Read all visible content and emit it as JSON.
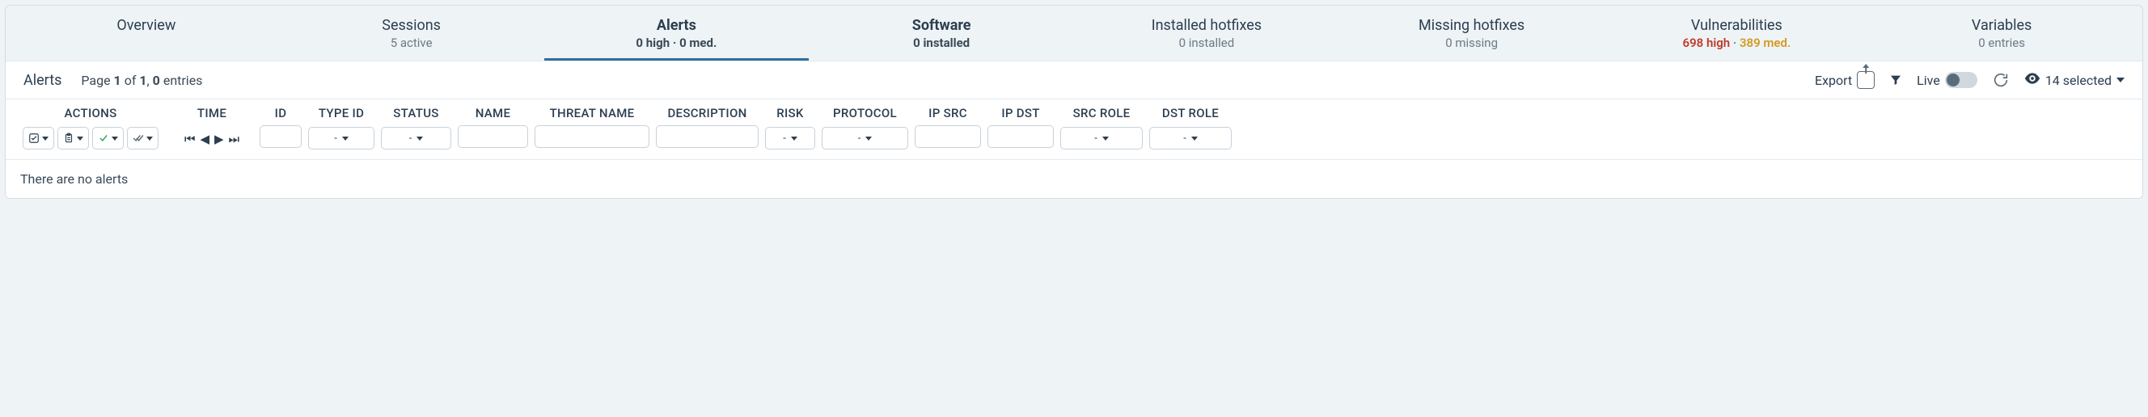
{
  "tabs": [
    {
      "title": "Overview",
      "subtitle": "",
      "bold": false,
      "active": false
    },
    {
      "title": "Sessions",
      "subtitle": "5 active",
      "bold": false,
      "active": false
    },
    {
      "title": "Alerts",
      "subtitle": "0 high · 0 med.",
      "bold": true,
      "active": true
    },
    {
      "title": "Software",
      "subtitle": "0 installed",
      "bold": true,
      "active": false
    },
    {
      "title": "Installed hotfixes",
      "subtitle": "0 installed",
      "bold": false,
      "active": false
    },
    {
      "title": "Missing hotfixes",
      "subtitle": "0 missing",
      "bold": false,
      "active": false
    },
    {
      "title": "Vulnerabilities",
      "subtitle_vuln": {
        "high": "698 high",
        "sep": " · ",
        "med": "389 med."
      },
      "bold": false,
      "active": false
    },
    {
      "title": "Variables",
      "subtitle": "0 entries",
      "bold": false,
      "active": false
    }
  ],
  "bar": {
    "section_title": "Alerts",
    "page_prefix": "Page ",
    "page_current": "1",
    "page_of": " of ",
    "page_total": "1",
    "page_sep": ", ",
    "entries_count": "0",
    "entries_suffix": " entries",
    "export_label": "Export",
    "live_label": "Live",
    "selected_count": "14 selected"
  },
  "columns": {
    "actions": "ACTIONS",
    "time": "TIME",
    "id": "ID",
    "typeid": "TYPE ID",
    "status": "STATUS",
    "name": "NAME",
    "threat": "THREAT NAME",
    "desc": "DESCRIPTION",
    "risk": "RISK",
    "proto": "PROTOCOL",
    "ipsrc": "IP SRC",
    "ipdst": "IP DST",
    "srcrole": "SRC ROLE",
    "dstrole": "DST ROLE"
  },
  "filters": {
    "dash": "-"
  },
  "empty_text": "There are no alerts"
}
